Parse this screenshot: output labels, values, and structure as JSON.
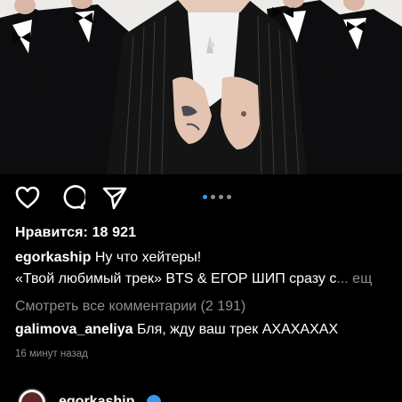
{
  "post": {
    "likes_label": "Нравится:",
    "likes_count": "18 921",
    "author_username": "egorkaship",
    "caption_line1": "Ну что хейтеры!",
    "caption_line2": "«Твой любимый трек» BTS & ЕГОР ШИП сразу с",
    "caption_truncation": "...",
    "caption_more": "ещ",
    "view_comments": "Смотреть все комментарии (2 191)",
    "comment": {
      "username": "galimova_aneliya",
      "text": "Бля, жду ваш трек АХАХАХАХ"
    },
    "timestamp": "16 минут назад",
    "carousel": {
      "total": 4,
      "active_index": 0
    }
  },
  "icons": {
    "like": "heart-icon",
    "comment": "comment-bubble-icon",
    "share": "paper-plane-icon",
    "verified": "verified-badge-icon"
  },
  "next_post": {
    "username": "egorkaship"
  },
  "colors": {
    "background": "#000000",
    "text": "#ffffff",
    "secondary_text": "#8e8e8e",
    "accent": "#3897f0"
  }
}
